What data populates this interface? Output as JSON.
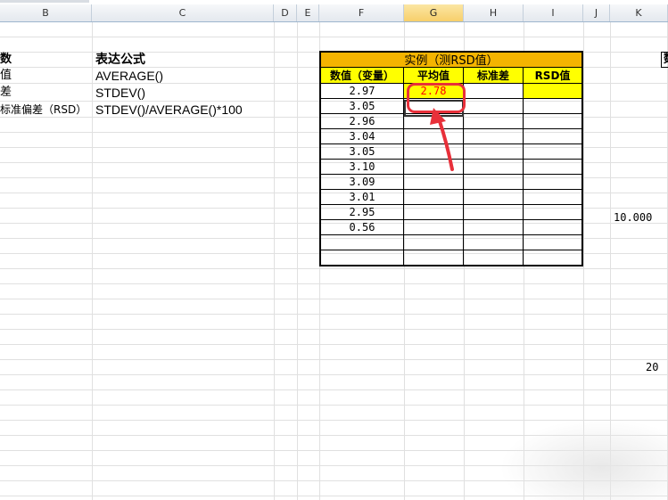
{
  "column_headers": [
    "B",
    "C",
    "D",
    "E",
    "F",
    "G",
    "H",
    "I",
    "J",
    "K"
  ],
  "left_section": {
    "header_a": "数",
    "header_b": "表达公式",
    "rows": [
      {
        "name": "值",
        "formula": "AVERAGE()"
      },
      {
        "name": "差",
        "formula": "STDEV()"
      },
      {
        "name": "标准偏差（RSD）",
        "formula": "STDEV()/AVERAGE()*100"
      }
    ]
  },
  "table": {
    "title": "实例（测RSD值）",
    "headers": [
      "数值（变量）",
      "平均值",
      "标准差",
      "RSD值"
    ],
    "values": [
      "2.97",
      "3.05",
      "2.96",
      "3.04",
      "3.05",
      "3.10",
      "3.09",
      "3.01",
      "2.95",
      "0.56"
    ],
    "average_value": "2.78"
  },
  "right_values": {
    "k_value_1": "10.000",
    "k_value_2": "20",
    "partial_char": "数"
  },
  "colors": {
    "title_bg": "#f4b400",
    "header_bg": "#ffff00",
    "highlight": "#ffff00",
    "accent_red": "#e8303a"
  }
}
